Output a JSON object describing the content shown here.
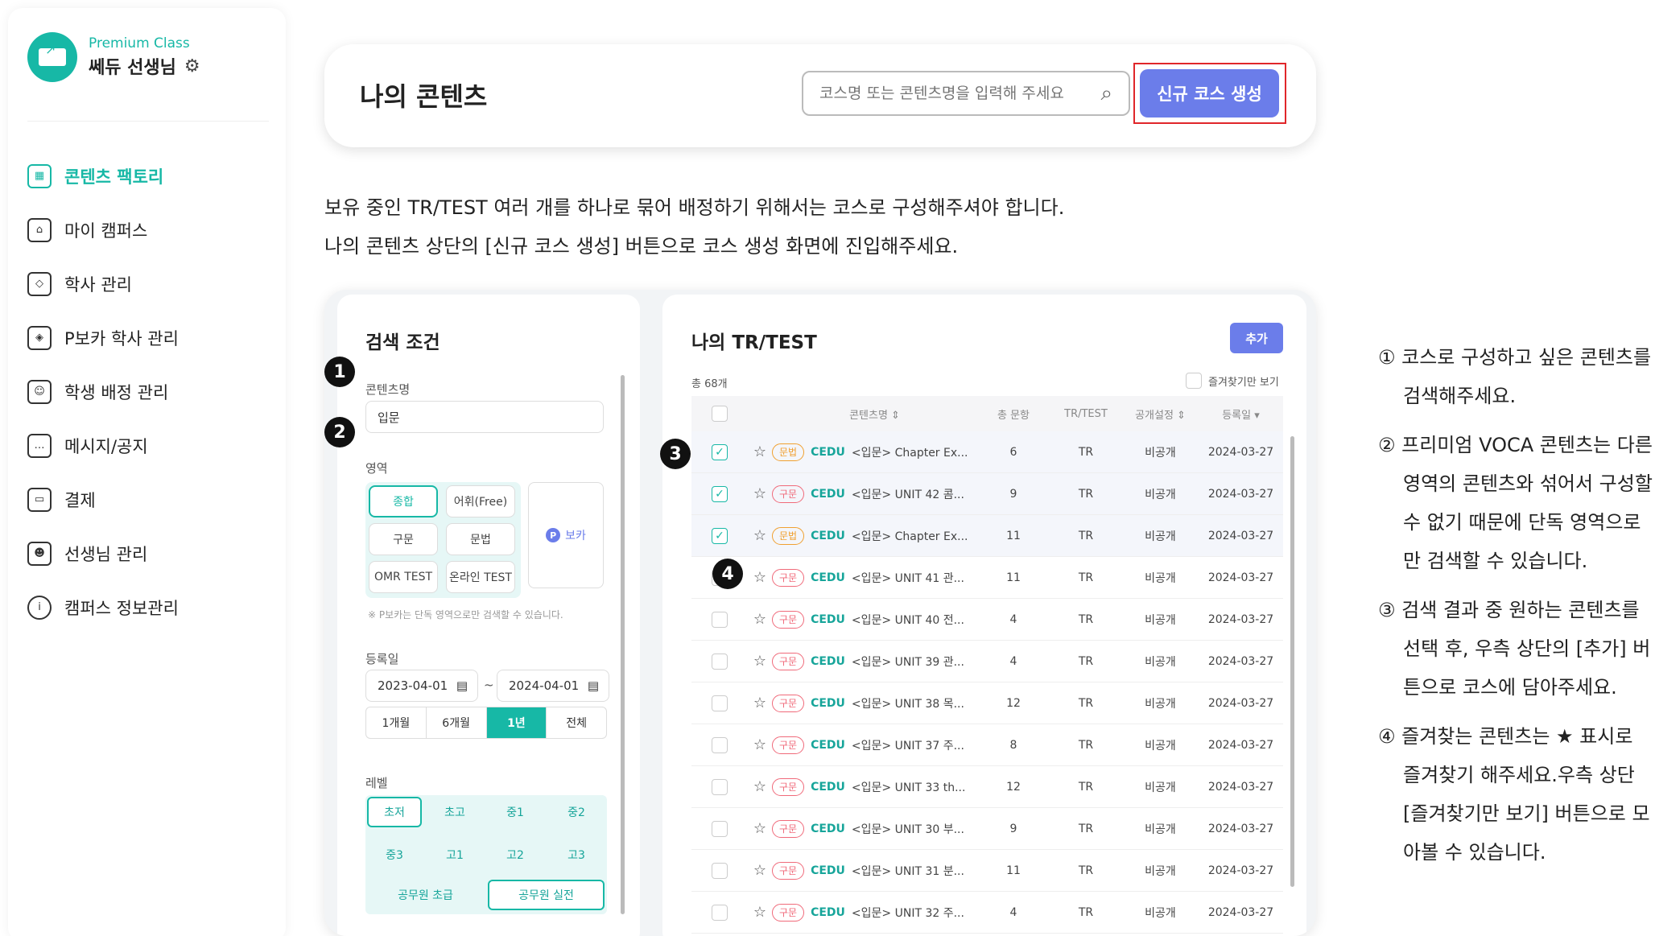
{
  "sidebar": {
    "tier": "Premium Class",
    "teacher": "쎄듀 선생님",
    "items": [
      {
        "label": "콘텐츠 팩토리",
        "icon": "content-factory-icon",
        "active": true
      },
      {
        "label": "마이 캠퍼스",
        "icon": "campus-icon"
      },
      {
        "label": "학사 관리",
        "icon": "graduation-cap-icon"
      },
      {
        "label": "P보카 학사 관리",
        "icon": "pvoca-cap-icon"
      },
      {
        "label": "학생 배정 관리",
        "icon": "student-assign-icon"
      },
      {
        "label": "메시지/공지",
        "icon": "message-icon"
      },
      {
        "label": "결제",
        "icon": "card-icon"
      },
      {
        "label": "선생님 관리",
        "icon": "teacher-icon"
      },
      {
        "label": "캠퍼스 정보관리",
        "icon": "info-icon"
      }
    ]
  },
  "header": {
    "title": "나의 콘텐츠",
    "search_placeholder": "코스명 또는 콘텐츠명을 입력해 주세요",
    "new_course": "신규 코스 생성"
  },
  "description": {
    "line1": "보유 중인 TR/TEST 여러 개를 하나로 묶어 배정하기 위해서는 코스로 구성해주셔야 합니다.",
    "line2": "나의 콘텐츠 상단의 [신규 코스 생성] 버튼으로 코스 생성 화면에 진입해주세요."
  },
  "filter": {
    "title": "검색 조건",
    "name_label": "콘텐츠명",
    "name_value": "입문",
    "area_label": "영역",
    "areas": [
      "종합",
      "어휘(Free)",
      "구문",
      "문법",
      "OMR TEST",
      "온라인 TEST"
    ],
    "voca": "보카",
    "voca_badge": "P",
    "note": "※ P보카는 단독 영역으로만 검색할 수 있습니다.",
    "date_label": "등록일",
    "date_from": "2023-04-01",
    "date_sep": "~",
    "date_to": "2024-04-01",
    "periods": [
      "1개월",
      "6개월",
      "1년",
      "전체"
    ],
    "level_label": "레벨",
    "levels": [
      "초저",
      "초고",
      "중1",
      "중2",
      "중3",
      "고1",
      "고2",
      "고3",
      "공무원 초급",
      "공무원 실전"
    ]
  },
  "list": {
    "title": "나의 TR/TEST",
    "add": "추가",
    "total": "총 68개",
    "fav_only": "즐겨찾기만 보기",
    "headers": {
      "name": "콘텐츠명 ⇕",
      "questions": "총 문항",
      "type": "TR/TEST",
      "visibility": "공개설정 ⇕",
      "date": "등록일 ▾"
    },
    "rows": [
      {
        "checked": true,
        "tag": "문법",
        "kind": "grammar",
        "brand": "CEDU",
        "name": "<입문> Chapter Ex...",
        "q": "6",
        "type": "TR",
        "pub": "비공개",
        "date": "2024-03-27"
      },
      {
        "checked": true,
        "tag": "구문",
        "kind": "phrase",
        "brand": "CEDU",
        "name": "<입문> UNIT 42 콤...",
        "q": "9",
        "type": "TR",
        "pub": "비공개",
        "date": "2024-03-27"
      },
      {
        "checked": true,
        "tag": "문법",
        "kind": "grammar",
        "brand": "CEDU",
        "name": "<입문> Chapter Ex...",
        "q": "11",
        "type": "TR",
        "pub": "비공개",
        "date": "2024-03-27"
      },
      {
        "checked": false,
        "tag": "구문",
        "kind": "phrase",
        "brand": "CEDU",
        "name": "<입문> UNIT 41 관...",
        "q": "11",
        "type": "TR",
        "pub": "비공개",
        "date": "2024-03-27"
      },
      {
        "checked": false,
        "tag": "구문",
        "kind": "phrase",
        "brand": "CEDU",
        "name": "<입문> UNIT 40 전...",
        "q": "4",
        "type": "TR",
        "pub": "비공개",
        "date": "2024-03-27"
      },
      {
        "checked": false,
        "tag": "구문",
        "kind": "phrase",
        "brand": "CEDU",
        "name": "<입문> UNIT 39 관...",
        "q": "4",
        "type": "TR",
        "pub": "비공개",
        "date": "2024-03-27"
      },
      {
        "checked": false,
        "tag": "구문",
        "kind": "phrase",
        "brand": "CEDU",
        "name": "<입문> UNIT 38 목...",
        "q": "12",
        "type": "TR",
        "pub": "비공개",
        "date": "2024-03-27"
      },
      {
        "checked": false,
        "tag": "구문",
        "kind": "phrase",
        "brand": "CEDU",
        "name": "<입문> UNIT 37 주...",
        "q": "8",
        "type": "TR",
        "pub": "비공개",
        "date": "2024-03-27"
      },
      {
        "checked": false,
        "tag": "구문",
        "kind": "phrase",
        "brand": "CEDU",
        "name": "<입문> UNIT 33 th...",
        "q": "12",
        "type": "TR",
        "pub": "비공개",
        "date": "2024-03-27"
      },
      {
        "checked": false,
        "tag": "구문",
        "kind": "phrase",
        "brand": "CEDU",
        "name": "<입문> UNIT 30 부...",
        "q": "9",
        "type": "TR",
        "pub": "비공개",
        "date": "2024-03-27"
      },
      {
        "checked": false,
        "tag": "구문",
        "kind": "phrase",
        "brand": "CEDU",
        "name": "<입문> UNIT 31 분...",
        "q": "11",
        "type": "TR",
        "pub": "비공개",
        "date": "2024-03-27"
      },
      {
        "checked": false,
        "tag": "구문",
        "kind": "phrase",
        "brand": "CEDU",
        "name": "<입문> UNIT 32 주...",
        "q": "4",
        "type": "TR",
        "pub": "비공개",
        "date": "2024-03-27"
      }
    ]
  },
  "markers": [
    "1",
    "2",
    "3",
    "4"
  ],
  "instructions": [
    "① 코스로 구성하고 싶은 콘텐츠를 검색해주세요.",
    "② 프리미엄 VOCA 콘텐츠는 다른 영역의 콘텐츠와 섞어서 구성할 수 없기 때문에 단독 영역으로만 검색할 수 있습니다.",
    "③ 검색 결과 중 원하는 콘텐츠를 선택 후, 우측 상단의 [추가] 버튼으로 코스에 담아주세요.",
    "④ 즐겨찾는 콘텐츠는 ★ 표시로 즐겨찾기 해주세요.우측 상단 [즐겨찾기만 보기] 버튼으로 모아볼 수 있습니다."
  ],
  "colors": {
    "accent": "#17b8a6",
    "primary_button": "#6b7dea",
    "highlight_border": "#e0262a"
  }
}
